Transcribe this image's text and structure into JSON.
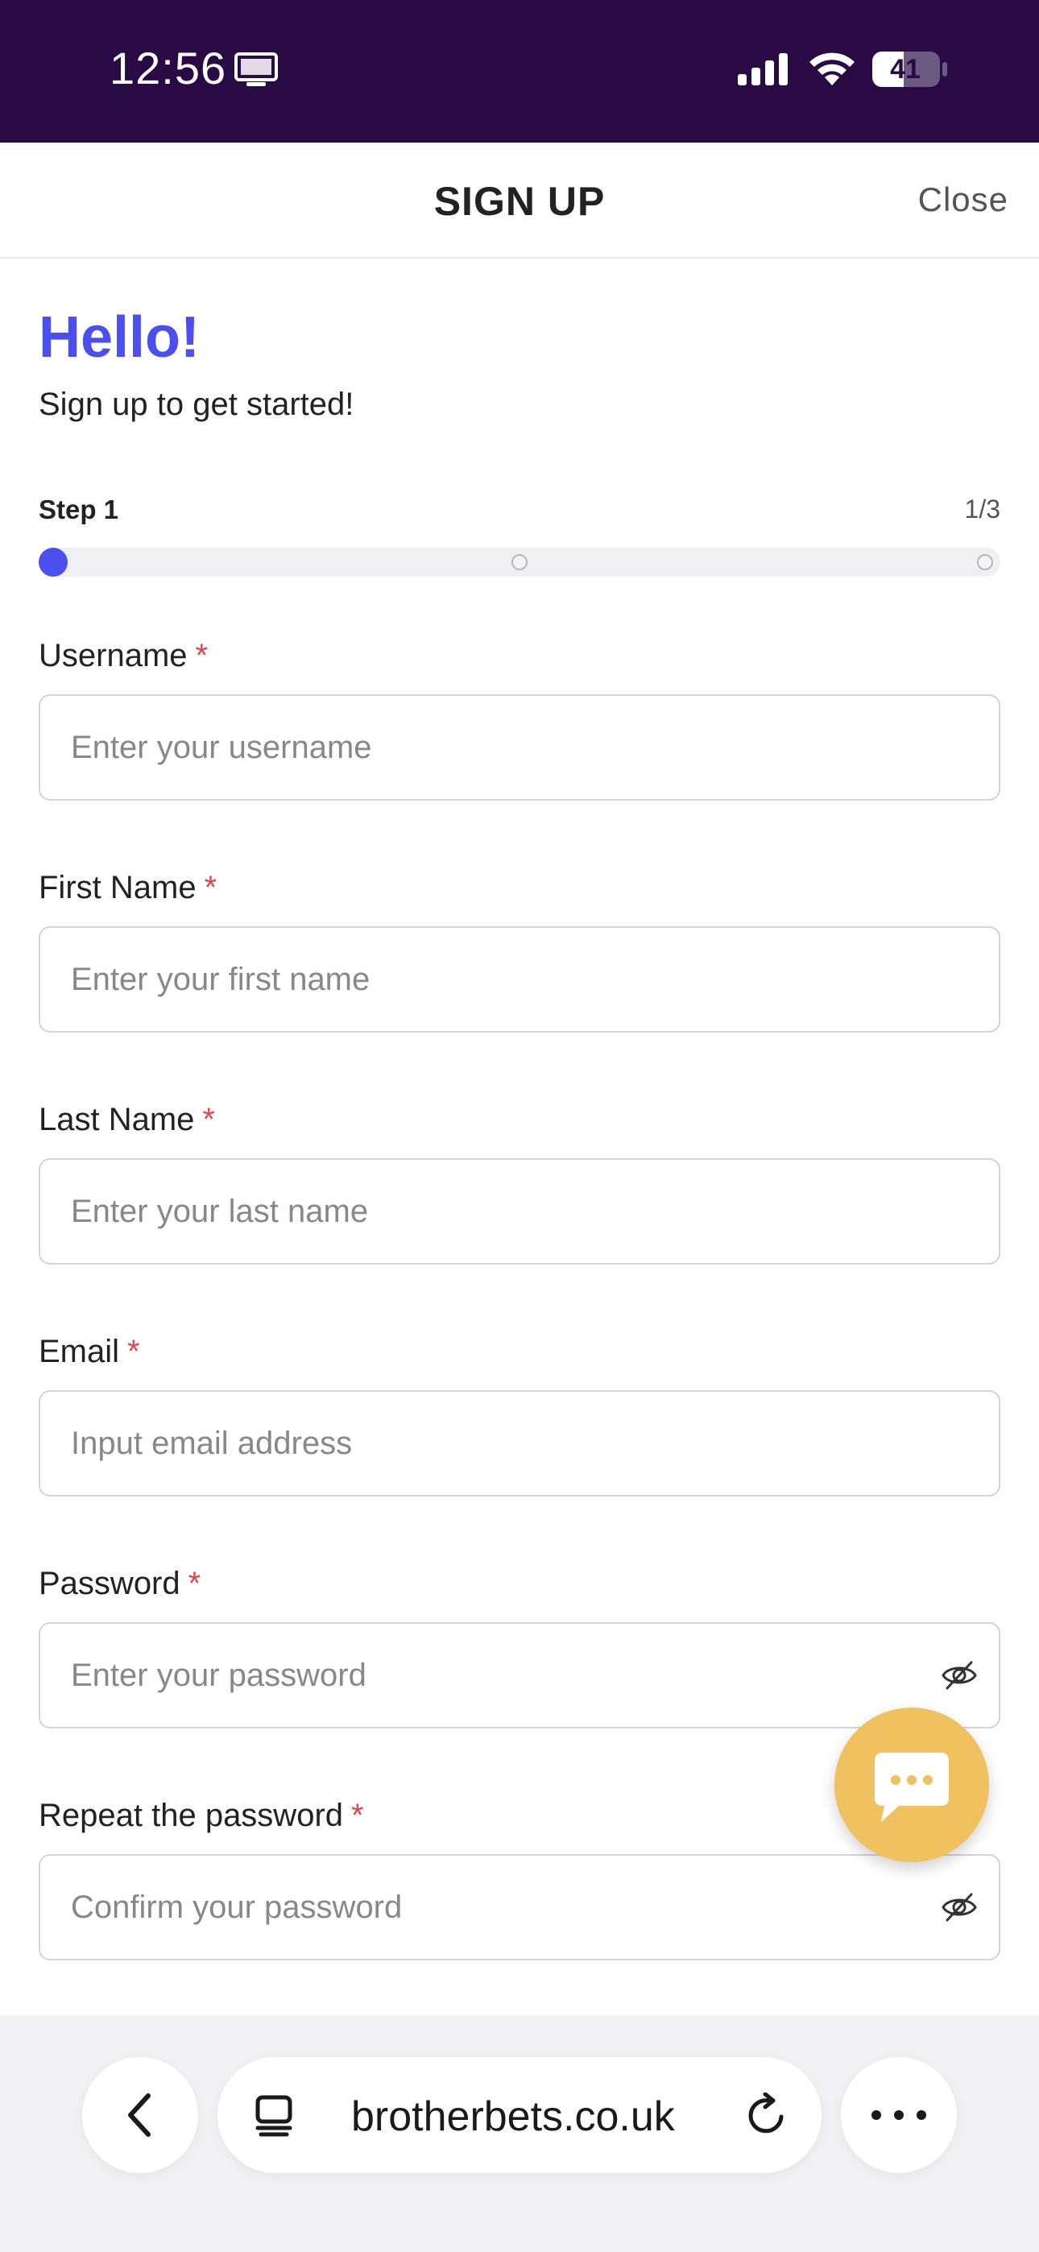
{
  "status_bar": {
    "time": "12:56",
    "battery": "41",
    "icons": [
      "screen-mirroring-icon",
      "cellular-signal-icon",
      "wifi-icon",
      "battery-icon"
    ]
  },
  "header": {
    "title": "SIGN UP",
    "close_label": "Close"
  },
  "greeting": {
    "title": "Hello!",
    "subtitle": "Sign up to get started!"
  },
  "steps": {
    "label": "Step 1",
    "count": "1/3",
    "current": 1,
    "total": 3
  },
  "form": {
    "username": {
      "label": "Username",
      "placeholder": "Enter your username",
      "value": ""
    },
    "first_name": {
      "label": "First Name",
      "placeholder": "Enter your first name",
      "value": ""
    },
    "last_name": {
      "label": "Last Name",
      "placeholder": "Enter your last name",
      "value": ""
    },
    "email": {
      "label": "Email",
      "placeholder": "Input email address",
      "value": ""
    },
    "password": {
      "label": "Password",
      "placeholder": "Enter your password",
      "value": ""
    },
    "repeat_password": {
      "label": "Repeat the password",
      "placeholder": "Confirm your password",
      "value": ""
    },
    "required_mark": "*"
  },
  "chat": {
    "icon": "chat-bubble-icon"
  },
  "browser": {
    "url": "brotherbets.co.uk",
    "icons": [
      "back-arrow-icon",
      "tabs-icon",
      "reload-icon",
      "more-icon"
    ]
  },
  "colors": {
    "status_bar_bg": "#2a0a45",
    "accent": "#4b4ff0",
    "required": "#e0474c",
    "chat_fab": "#efc25f"
  }
}
